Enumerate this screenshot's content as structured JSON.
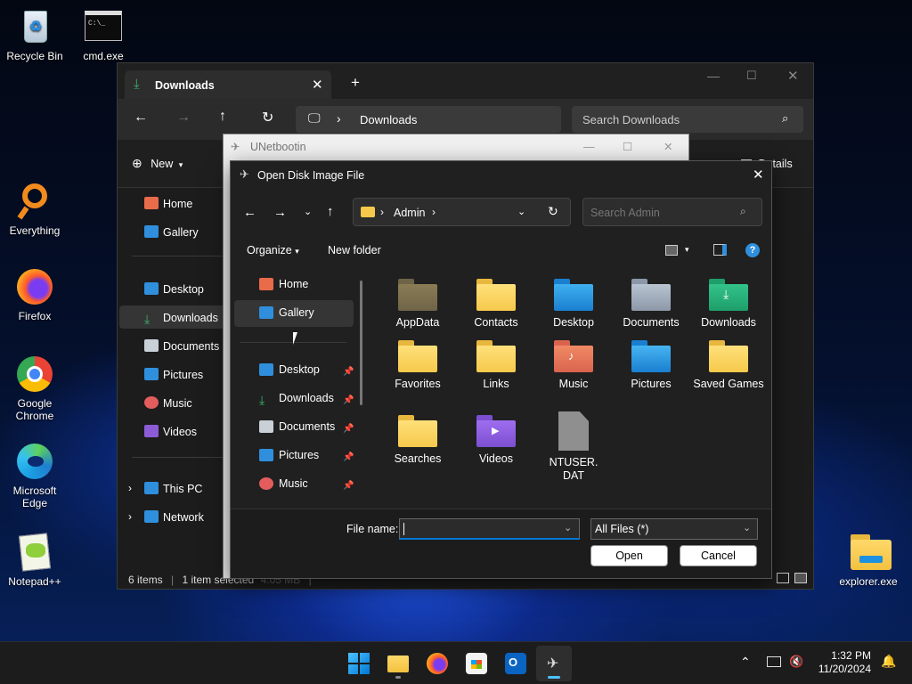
{
  "desktop": {
    "icons": [
      {
        "label": "Recycle Bin",
        "icon": "recycle-bin-icon"
      },
      {
        "label": "cmd.exe",
        "icon": "cmd-icon"
      },
      {
        "label": "Everything",
        "icon": "everything-icon"
      },
      {
        "label": "Firefox",
        "icon": "firefox-icon"
      },
      {
        "label": "Google Chrome",
        "icon": "chrome-icon"
      },
      {
        "label": "Microsoft Edge",
        "icon": "edge-icon"
      },
      {
        "label": "Notepad++",
        "icon": "notepadpp-icon"
      },
      {
        "label": "explorer.exe",
        "icon": "explorer-icon"
      }
    ]
  },
  "explorer": {
    "tab_title": "Downloads",
    "address": "Downloads",
    "search_placeholder": "Search Downloads",
    "new_label": "New",
    "details_label": "Details",
    "nav": [
      "Home",
      "Gallery",
      "Desktop",
      "Downloads",
      "Documents",
      "Pictures",
      "Music",
      "Videos",
      "This PC",
      "Network"
    ],
    "status": {
      "items": "6 items",
      "selected": "1 item selected",
      "size": "4.05 MB"
    }
  },
  "unetbootin": {
    "title": "UNetbootin"
  },
  "dialog": {
    "title": "Open Disk Image File",
    "breadcrumb": "Admin",
    "search_placeholder": "Search Admin",
    "organize": "Organize",
    "new_folder": "New folder",
    "tree": [
      {
        "label": "Home",
        "pinned": false
      },
      {
        "label": "Gallery",
        "pinned": false
      },
      {
        "label": "Desktop",
        "pinned": true
      },
      {
        "label": "Downloads",
        "pinned": true
      },
      {
        "label": "Documents",
        "pinned": true
      },
      {
        "label": "Pictures",
        "pinned": true
      },
      {
        "label": "Music",
        "pinned": true
      }
    ],
    "folders": [
      "AppData",
      "Contacts",
      "Desktop",
      "Documents",
      "Downloads",
      "Favorites",
      "Links",
      "Music",
      "Pictures",
      "Saved Games",
      "Searches",
      "Videos",
      "NTUSER.DAT"
    ],
    "file_name_label": "File name:",
    "file_name_value": "",
    "file_type": "All Files (*)",
    "open": "Open",
    "cancel": "Cancel"
  },
  "taskbar": {
    "time": "1:32 PM",
    "date": "11/20/2024"
  },
  "colors": {
    "accent": "#0078d4",
    "folder": "#f6c94b",
    "dark": "#202020"
  }
}
